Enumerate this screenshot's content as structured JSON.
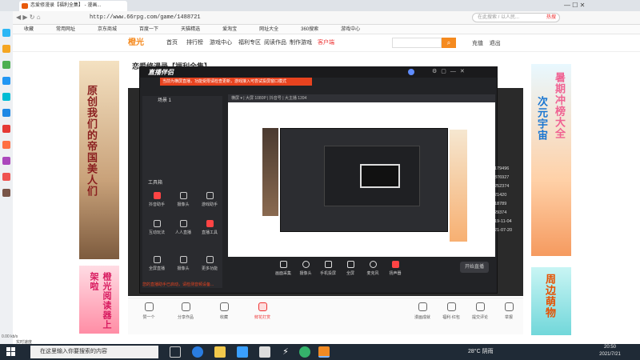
{
  "browser": {
    "tab_title": "恋爱修漫录【福利全集】 - 漫画...",
    "url": "http://www.66rpg.com/game/1488721",
    "search_placeholder": "在此搜索 / 以人民...",
    "search_tag": "热搜",
    "window_controls": "—  ☐  ✕",
    "bookmarks": [
      "收藏",
      "常用网址",
      "京东商城",
      "百度一下",
      "天猫精选",
      "爱淘宝",
      "网址大全",
      "360搜索",
      "游戏中心"
    ]
  },
  "site": {
    "logo": "橙光",
    "nav": [
      "首页",
      "排行榜",
      "游戏中心",
      "福利专区",
      "阅读作品",
      "制作游戏",
      "客户端"
    ],
    "user_links": [
      "充值",
      "退出"
    ],
    "page_title": "恋爱修漫录【福利全集】",
    "left_banner_text": "原创我们的帝国美人们",
    "left_banner2_text": "橙光阅读器上架啦",
    "right_banner_text": "暑期冲榜大全",
    "right_banner_sub": "次元宇宙",
    "right_banner2_text": "周边萌物",
    "actions": [
      "赞一个",
      "分享作品",
      "收藏",
      "鲜花打赏",
      "漫画成就",
      "福利·红包",
      "提交评论",
      "举报"
    ]
  },
  "live_app": {
    "title": "直播伴侣",
    "warning": "当前为横屏直播，功能受限请检查更新，游戏接入可尝试投屏窗口模式",
    "scene_label": "场景 1",
    "tools_label": "工具箱",
    "tools": [
      "抖音助手",
      "摄像头",
      "游戏助手",
      "互动玩法",
      "人人直播",
      "直播工具",
      "全屏直播",
      "摄像头",
      "更多功能"
    ],
    "preview_bar": "横屏 ▾  | 大屏 1080P  | 抖音号  | 大主播 1394",
    "bottom_tools": [
      "画面采集",
      "摄像头",
      "手机投屏",
      "全屏",
      "麦克风",
      "扬声器"
    ],
    "start_button": "开始直播",
    "bottom_note": "您的直播助手已启动，请检测音频设备..."
  },
  "stats": [
    "179496",
    "376927",
    "252374",
    "21420",
    "18789",
    "29374",
    "19-11-04",
    "21-07-20"
  ],
  "taskbar": {
    "search_placeholder": "在这里输入你要搜索的内容",
    "weather": "28°C 阴雨",
    "time": "20:50",
    "date": "2021/7/21"
  },
  "status_line": "0.00 kb/s",
  "status_line2": "实时速度"
}
